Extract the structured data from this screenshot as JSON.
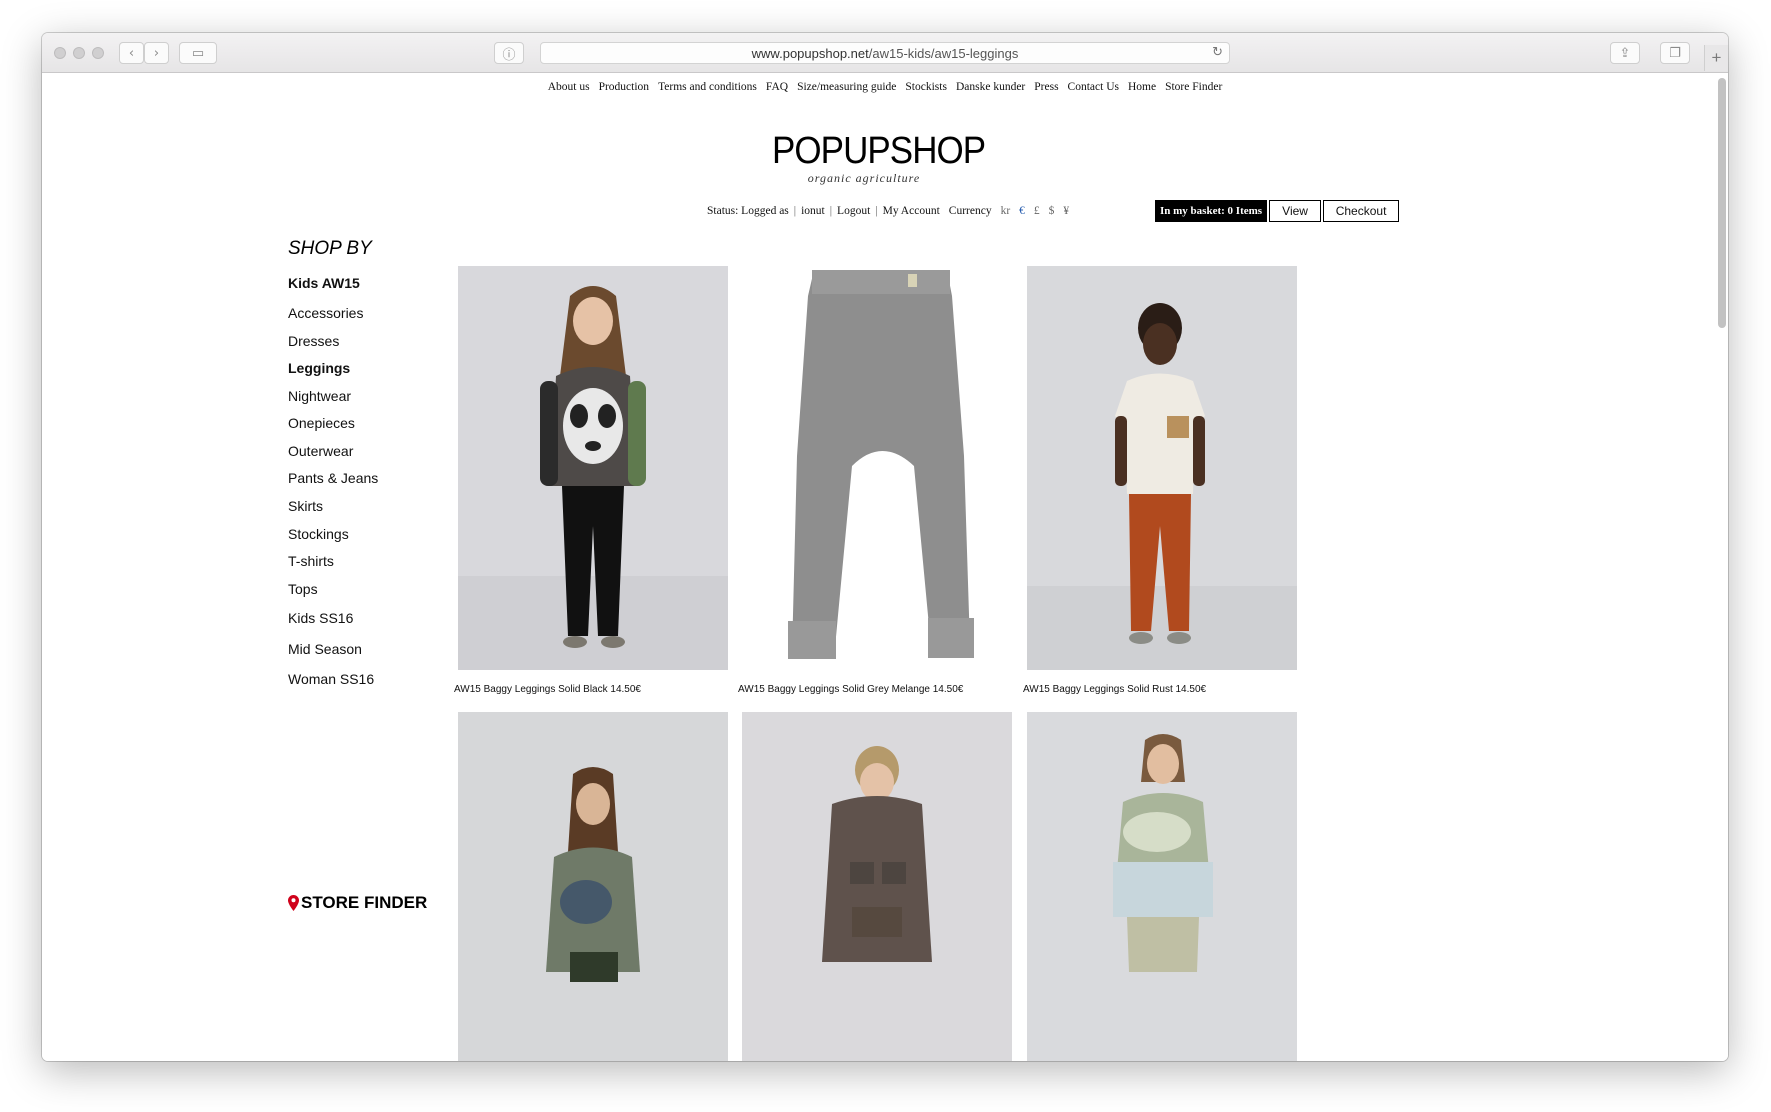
{
  "browser": {
    "url_host": "www.popupshop.net",
    "url_path": "/aw15-kids/aw15-leggings"
  },
  "topnav": [
    "About us",
    "Production",
    "Terms and conditions",
    "FAQ",
    "Size/measuring guide",
    "Stockists",
    "Danske kunder",
    "Press",
    "Contact Us",
    "Home",
    "Store Finder"
  ],
  "logo": {
    "name": "POPUPSHOP",
    "tagline": "organic agriculture"
  },
  "status": {
    "status_label": "Status: Logged as",
    "username": "ionut",
    "logout": "Logout",
    "my_account": "My Account",
    "currency_label": "Currency",
    "currencies": [
      "kr",
      "€",
      "£",
      "$",
      "¥"
    ]
  },
  "basket": {
    "label": "In my basket: 0 Items",
    "view": "View",
    "checkout": "Checkout"
  },
  "sidebar": {
    "heading": "SHOP BY",
    "items": [
      "Kids AW15",
      "Accessories",
      "Dresses",
      "Leggings",
      "Nightwear",
      "Onepieces",
      "Outerwear",
      "Pants & Jeans",
      "Skirts",
      "Stockings",
      "T-shirts",
      "Tops",
      "Kids SS16",
      "Mid Season",
      "Woman SS16"
    ]
  },
  "store_finder": "STORE FINDER",
  "products": [
    {
      "caption": "AW15 Baggy Leggings Solid Black 14.50€"
    },
    {
      "caption": "AW15 Baggy Leggings Solid Grey Melange  14.50€"
    },
    {
      "caption": "AW15 Baggy Leggings Solid Rust 14.50€"
    },
    {
      "caption": ""
    },
    {
      "caption": ""
    },
    {
      "caption": ""
    }
  ],
  "colors": {
    "accent_currency": "#2a5fb0",
    "pin": "#d0021b"
  }
}
